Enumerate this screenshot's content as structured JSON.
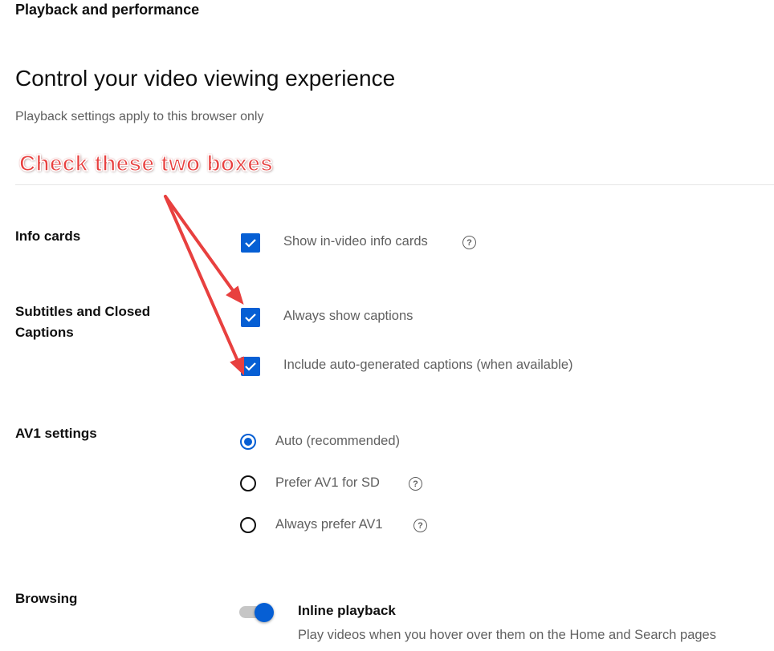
{
  "header": {
    "title": "Playback and performance"
  },
  "main": {
    "heading": "Control your video viewing experience",
    "subheading": "Playback settings apply to this browser only"
  },
  "annotation": {
    "text": "Check these two boxes",
    "color": "#e8403f"
  },
  "sections": {
    "info_cards": {
      "label": "Info cards",
      "option": {
        "label": "Show in-video info cards",
        "checked": true
      }
    },
    "captions": {
      "label": "Subtitles and Closed Captions",
      "options": [
        {
          "label": "Always show captions",
          "checked": true
        },
        {
          "label": "Include auto-generated captions (when available)",
          "checked": true
        }
      ]
    },
    "av1": {
      "label": "AV1 settings",
      "options": [
        {
          "label": "Auto (recommended)",
          "selected": true
        },
        {
          "label": "Prefer AV1 for SD",
          "selected": false
        },
        {
          "label": "Always prefer AV1",
          "selected": false
        }
      ]
    },
    "browsing": {
      "label": "Browsing",
      "toggle": {
        "title": "Inline playback",
        "description": "Play videos when you hover over them on the Home and Search pages",
        "on": true
      }
    }
  },
  "help_glyph": "?",
  "accent": "#065fd4"
}
